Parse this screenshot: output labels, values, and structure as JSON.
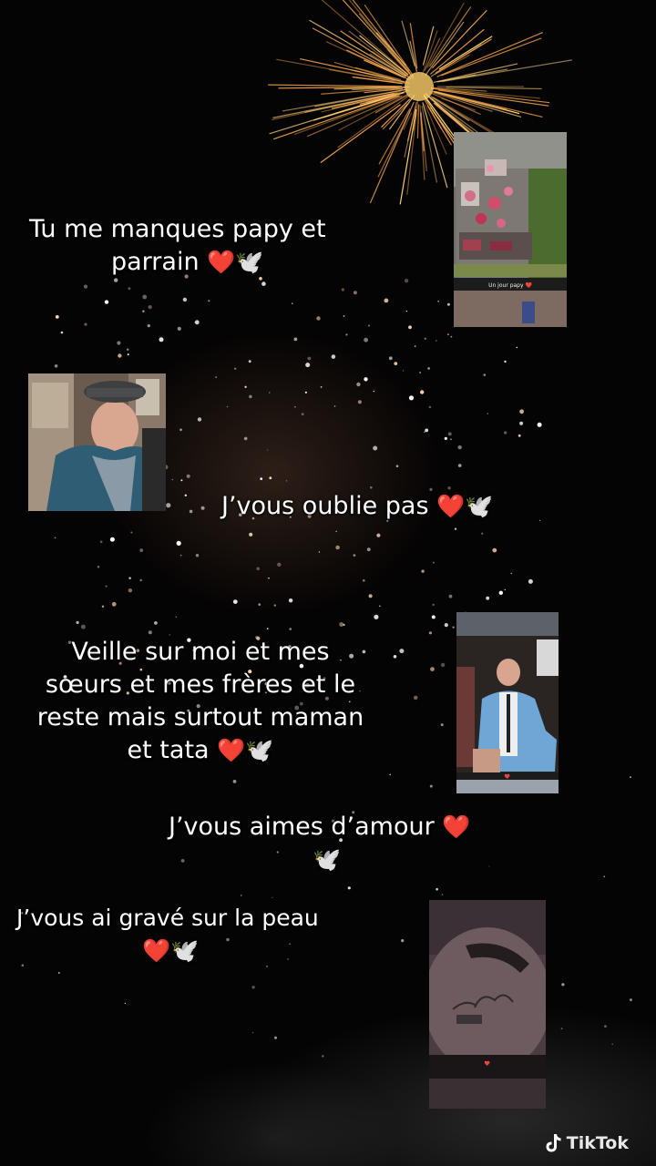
{
  "captions": {
    "c1_line1": "Tu me manques papy et",
    "c1_line2": "parrain",
    "c2": "J’vous oublie pas",
    "c3_line1": "Veille sur moi et mes",
    "c3_line2": "sœurs et mes frères et le",
    "c3_line3": "reste mais surtout maman",
    "c3_line4": "et tata",
    "c4": "J’vous aimes d’amour",
    "c5": "J’vous ai gravé sur la peau"
  },
  "emoji": {
    "heart": "❤️",
    "dove": "🕊️"
  },
  "watermark": {
    "brand": "TikTok"
  },
  "colors": {
    "heart": "#e3121f",
    "firework": "#ffb347",
    "text": "#ffffff"
  },
  "icons": [
    "tiktok-logo-icon",
    "heart-icon",
    "dove-icon"
  ]
}
